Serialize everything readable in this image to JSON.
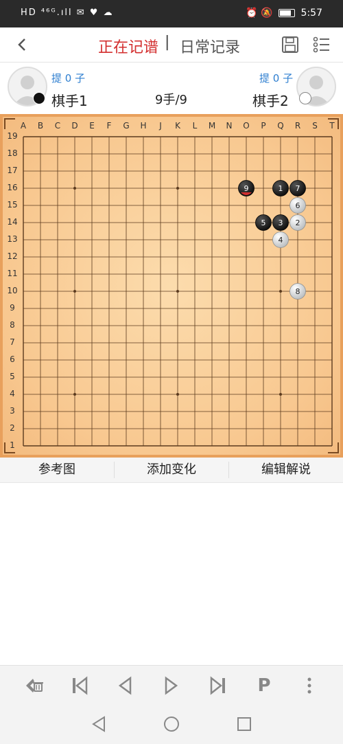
{
  "status_bar": {
    "left": "HD ⁴⁶ᴳ.ıll ✉ ♥ ☁",
    "time": "5:57"
  },
  "header": {
    "title_active": "正在记谱",
    "separator": "|",
    "title_inactive": "日常记录"
  },
  "players": {
    "black": {
      "name": "棋手1",
      "captures": "提 0 子"
    },
    "white": {
      "name": "棋手2",
      "captures": "提 0 子"
    },
    "move_counter": "9手/9"
  },
  "board": {
    "size": 19,
    "columns": [
      "A",
      "B",
      "C",
      "D",
      "E",
      "F",
      "G",
      "H",
      "J",
      "K",
      "L",
      "M",
      "N",
      "O",
      "P",
      "Q",
      "R",
      "S",
      "T"
    ],
    "rows": [
      "19",
      "18",
      "17",
      "16",
      "15",
      "14",
      "13",
      "12",
      "11",
      "10",
      "9",
      "8",
      "7",
      "6",
      "5",
      "4",
      "3",
      "2",
      "1"
    ],
    "colors": {
      "board": "#f8c890",
      "frame": "#e8a05c",
      "line": "#5b3a1e",
      "black": "#111111",
      "white": "#e8e8e8",
      "last_move": "#d32f2f"
    },
    "stones": [
      {
        "move": "1",
        "color": "black",
        "col": "Q",
        "row": "16"
      },
      {
        "move": "2",
        "color": "white",
        "col": "R",
        "row": "14"
      },
      {
        "move": "3",
        "color": "black",
        "col": "Q",
        "row": "14"
      },
      {
        "move": "4",
        "color": "white",
        "col": "Q",
        "row": "13"
      },
      {
        "move": "5",
        "color": "black",
        "col": "P",
        "row": "14"
      },
      {
        "move": "6",
        "color": "white",
        "col": "R",
        "row": "15"
      },
      {
        "move": "7",
        "color": "black",
        "col": "R",
        "row": "16"
      },
      {
        "move": "8",
        "color": "white",
        "col": "R",
        "row": "10"
      },
      {
        "move": "9",
        "color": "black",
        "col": "O",
        "row": "16",
        "last": true
      }
    ]
  },
  "actions": {
    "reference": "参考图",
    "add_variation": "添加变化",
    "edit_comment": "编辑解说"
  },
  "toolbar": {
    "icons": [
      "delete-back-icon",
      "first-move-icon",
      "prev-move-icon",
      "next-move-icon",
      "last-move-icon",
      "pass-icon",
      "more-icon"
    ],
    "pass_label": "P"
  }
}
